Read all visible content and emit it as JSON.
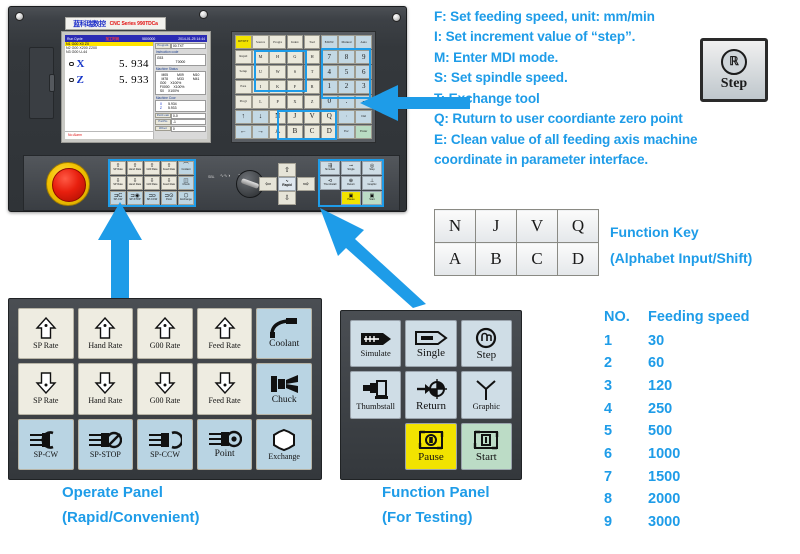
{
  "accent_color": "#1e9ce8",
  "device": {
    "brand_cn": "蓝科瑞数控",
    "brand_en": "CNC Series 990TDCa",
    "screen": {
      "titlebar_left": "Run  Cycle",
      "titlebar_mid": "加工时间",
      "titlebar_count": "5800000",
      "titlebar_right": "2014-01-25  14:44",
      "program_lines": [
        "N1 G00 X0 Z0",
        "N2 G00 X200 Z200",
        "N3 G00 U-44"
      ],
      "axes": [
        {
          "name": "X",
          "value": "5. 934"
        },
        {
          "name": "Z",
          "value": "5. 933"
        }
      ],
      "alarm_text": "No Alarm",
      "panels": {
        "program_label": "Program",
        "program_value": "00.TXT",
        "modal_label": "Instruction code",
        "modal_g": "G53",
        "modal_t": "T0000",
        "status_label": "Machine Status",
        "status_m": [
          "M05",
          "M09",
          "M10",
          "M78",
          "M33",
          "M41"
        ],
        "rate_rows": [
          {
            "k": "G00",
            "v": "X100%"
          },
          {
            "k": "F0000",
            "v": "X100%"
          },
          {
            "k": "S0",
            "v": "X100%"
          }
        ],
        "coord_label": "Machine Coor",
        "coord_rows": [
          {
            "k": "X",
            "v": "5.934"
          },
          {
            "k": "Z",
            "v": "5.933"
          }
        ],
        "extra_rows": [
          {
            "k": "PartCoun",
            "v": "0-0"
          },
          {
            "k": "PartNo",
            "v": "-1"
          },
          {
            "k": "Offset",
            "v": "0"
          }
        ]
      }
    },
    "keypad": {
      "row1": [
        "RESET",
        "Source",
        "Progra",
        "Index",
        "Tool",
        "EditNc",
        "Manual",
        "Auto"
      ],
      "row2": [
        "Rapid",
        "M",
        "H",
        "G",
        "H",
        "7",
        "8",
        "9"
      ],
      "row3": [
        "Setup",
        "U",
        "W",
        "S",
        "T",
        "4",
        "5",
        "6"
      ],
      "row4": [
        "Para",
        "I",
        "K",
        "F",
        "R",
        "1",
        "2",
        "3"
      ],
      "row5": [
        "Progr",
        "L",
        "P",
        "X",
        "Z",
        "0",
        ".",
        "-"
      ],
      "row6": [
        "↑",
        "↓",
        "N",
        "J",
        "V",
        "Q",
        "/",
        "Del"
      ],
      "row7": [
        "←",
        "→",
        "A",
        "B",
        "C",
        "D",
        "Esc",
        "Enter"
      ]
    },
    "operate_keys_small": [
      {
        "label": "SP Rate",
        "icon": "arrow-up",
        "style": "light"
      },
      {
        "label": "Hand Rate",
        "icon": "arrow-up",
        "style": "light"
      },
      {
        "label": "G00 Rate",
        "icon": "arrow-up",
        "style": "light"
      },
      {
        "label": "Feed Rate",
        "icon": "arrow-up",
        "style": "light"
      },
      {
        "label": "Coolant",
        "icon": "coolant",
        "style": "blue"
      },
      {
        "label": "SP Rate",
        "icon": "arrow-down",
        "style": "light"
      },
      {
        "label": "Hand Rate",
        "icon": "arrow-down",
        "style": "light"
      },
      {
        "label": "G00 Rate",
        "icon": "arrow-down",
        "style": "light"
      },
      {
        "label": "Feed Rate",
        "icon": "arrow-down",
        "style": "light"
      },
      {
        "label": "Chuck",
        "icon": "chuck",
        "style": "blue"
      },
      {
        "label": "SP-CW",
        "icon": "sp-cw",
        "style": "blue"
      },
      {
        "label": "SP-STOP",
        "icon": "sp-stop",
        "style": "blue"
      },
      {
        "label": "SP-CCW",
        "icon": "sp-ccw",
        "style": "blue"
      },
      {
        "label": "Point",
        "icon": "point",
        "style": "blue"
      },
      {
        "label": "Exchange",
        "icon": "exchange",
        "style": "blue"
      }
    ],
    "nav": {
      "up": "⇧",
      "down": "⇩",
      "left": "⇦",
      "right": "⇨",
      "rapid": "Rapid"
    },
    "fn_keys_small": [
      {
        "label": "Simulate",
        "style": "blue"
      },
      {
        "label": "Single",
        "style": "blue"
      },
      {
        "label": "Step",
        "style": "blue"
      },
      {
        "label": "Thumbstall",
        "style": "blue"
      },
      {
        "label": "Return",
        "style": "blue"
      },
      {
        "label": "Graphic",
        "style": "blue"
      },
      {
        "label": "",
        "style": "none"
      },
      {
        "label": "Pause",
        "style": "yellow"
      },
      {
        "label": "Start",
        "style": "green"
      }
    ]
  },
  "legend": {
    "lines": [
      "F: Set feeding speed, unit: mm/min",
      "I: Set increment value of “step”.",
      "M: Enter MDI mode.",
      "S: Set spindle speed.",
      "T: Exchange tool",
      "Q: Ruturn to user coordiante zero point",
      "E: Clean value of all feeding axis machine",
      "coordinate in parameter interface."
    ]
  },
  "step_button": {
    "glyph": "ℝ",
    "label": "Step"
  },
  "function_key_table": {
    "rows": [
      [
        "N",
        "J",
        "V",
        "Q"
      ],
      [
        "A",
        "B",
        "C",
        "D"
      ]
    ],
    "caption_1": "Function Key",
    "caption_2": "(Alphabet Input/Shift)"
  },
  "operate_panel": {
    "keys": [
      {
        "label": "SP Rate",
        "icon": "arrow-up-dot",
        "style": "light"
      },
      {
        "label": "Hand Rate",
        "icon": "arrow-up-dot",
        "style": "light"
      },
      {
        "label": "G00 Rate",
        "icon": "arrow-up-dot",
        "style": "light"
      },
      {
        "label": "Feed Rate",
        "icon": "arrow-up-dot",
        "style": "light"
      },
      {
        "label": "Coolant",
        "icon": "coolant-tap",
        "style": "blue"
      },
      {
        "label": "SP Rate",
        "icon": "arrow-down-dot",
        "style": "light"
      },
      {
        "label": "Hand Rate",
        "icon": "arrow-down-dot",
        "style": "light"
      },
      {
        "label": "G00 Rate",
        "icon": "arrow-down-dot",
        "style": "light"
      },
      {
        "label": "Feed Rate",
        "icon": "arrow-down-dot",
        "style": "light"
      },
      {
        "label": "Chuck",
        "icon": "chuck-jaw",
        "style": "blue"
      },
      {
        "label": "SP-CW",
        "icon": "spindle-cw",
        "style": "blue"
      },
      {
        "label": "SP-STOP",
        "icon": "spindle-stop",
        "style": "blue"
      },
      {
        "label": "SP-CCW",
        "icon": "spindle-ccw",
        "style": "blue"
      },
      {
        "label": "Point",
        "icon": "spindle-point",
        "style": "blue"
      },
      {
        "label": "Exchange",
        "icon": "exchange-gear",
        "style": "blue"
      }
    ],
    "caption_1": "Operate Panel",
    "caption_2": "(Rapid/Convenient)"
  },
  "function_panel": {
    "keys": [
      {
        "label": "Simulate",
        "icon": "simulate-arrow",
        "style": "blue"
      },
      {
        "label": "Single",
        "icon": "single-block",
        "style": "blue"
      },
      {
        "label": "Step",
        "icon": "step-circle",
        "style": "blue"
      },
      {
        "label": "Thumbstall",
        "icon": "thumbstall",
        "style": "blue"
      },
      {
        "label": "Return",
        "icon": "return-target",
        "style": "blue"
      },
      {
        "label": "Graphic",
        "icon": "graphic-axes",
        "style": "blue"
      },
      {
        "label": "",
        "icon": "",
        "style": "empty"
      },
      {
        "label": "Pause",
        "icon": "pause-frame",
        "style": "yellow"
      },
      {
        "label": "Start",
        "icon": "start-frame",
        "style": "green"
      }
    ],
    "caption_1": "Function Panel",
    "caption_2": "(For Testing)"
  },
  "speed_table": {
    "header": {
      "no": "NO.",
      "speed": "Feeding speed"
    },
    "rows": [
      {
        "no": "1",
        "speed": "30"
      },
      {
        "no": "2",
        "speed": "60"
      },
      {
        "no": "3",
        "speed": "120"
      },
      {
        "no": "4",
        "speed": "250"
      },
      {
        "no": "5",
        "speed": "500"
      },
      {
        "no": "6",
        "speed": "1000"
      },
      {
        "no": "7",
        "speed": "1500"
      },
      {
        "no": "8",
        "speed": "2000"
      },
      {
        "no": "9",
        "speed": "3000"
      }
    ]
  }
}
